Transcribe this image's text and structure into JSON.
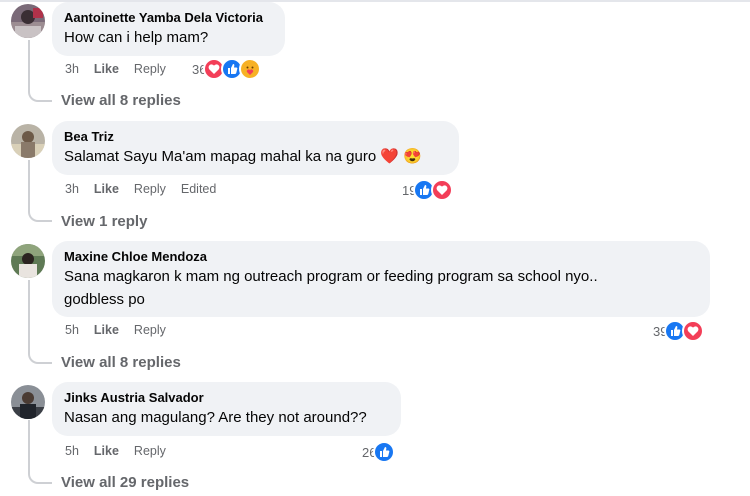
{
  "comments": [
    {
      "author": "Aantoinette Yamba Dela Victoria",
      "text": "How can i help mam?",
      "time": "3h",
      "like": "Like",
      "reply": "Reply",
      "edited": "",
      "reaction_count": "36",
      "reactions": [
        "heart",
        "like",
        "care"
      ],
      "view_replies": "View all 8 replies"
    },
    {
      "author": "Bea Triz",
      "text": "Salamat Sayu Ma'am mapag mahal ka na guro ❤️ 😍",
      "time": "3h",
      "like": "Like",
      "reply": "Reply",
      "edited": "Edited",
      "reaction_count": "19",
      "reactions": [
        "like",
        "heart"
      ],
      "view_replies": "View 1 reply"
    },
    {
      "author": "Maxine Chloe Mendoza",
      "text_line1": "Sana magkaron k mam ng outreach program or feeding program sa school nyo..",
      "text_line2": "godbless po",
      "time": "5h",
      "like": "Like",
      "reply": "Reply",
      "edited": "",
      "reaction_count": "39",
      "reactions": [
        "like",
        "heart"
      ],
      "view_replies": "View all 8 replies"
    },
    {
      "author": "Jinks Austria Salvador",
      "text": "Nasan ang magulang? Are they not around??",
      "time": "5h",
      "like": "Like",
      "reply": "Reply",
      "edited": "",
      "reaction_count": "26",
      "reactions": [
        "like"
      ],
      "view_replies": "View all 29 replies"
    }
  ],
  "colors": {
    "like": "#1877f2",
    "heart": "#f33e58",
    "care": "#f7b125",
    "bubble": "#f0f2f5",
    "meta": "#65676b"
  }
}
